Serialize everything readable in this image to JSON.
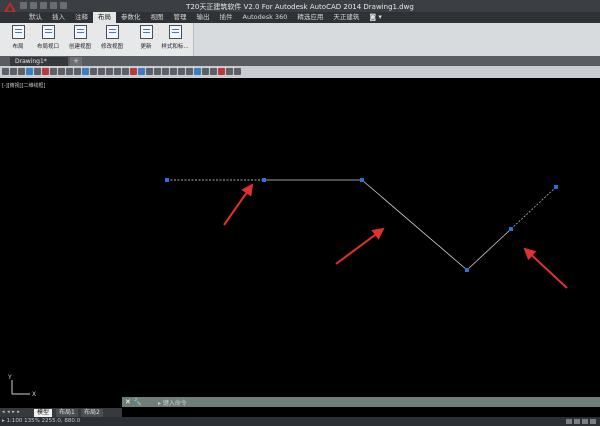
{
  "window": {
    "title": "T20天正建筑软件 V2.0 For Autodesk AutoCAD 2014    Drawing1.dwg",
    "logo_icon": "autocad-logo-icon"
  },
  "ribbon": {
    "tabs": [
      "默认",
      "插入",
      "注释",
      "布局",
      "参数化",
      "视图",
      "管理",
      "输出",
      "插件",
      "Autodesk 360",
      "精选应用",
      "天正建筑"
    ],
    "active_tab": "布局",
    "extra": "◙ ▾",
    "buttons": [
      {
        "label": "布局",
        "icon": "layout-icon"
      },
      {
        "label": "布局视口",
        "icon": "layout-viewport-icon"
      },
      {
        "label": "创建视图",
        "icon": "create-view-icon"
      },
      {
        "label": "修改视图",
        "icon": "modify-view-icon"
      },
      {
        "label": "更新",
        "icon": "update-icon"
      },
      {
        "label": "样式和标...",
        "icon": "styles-icon"
      }
    ]
  },
  "document": {
    "tab_label": "Drawing1*",
    "new_tab_icon": "+"
  },
  "viewport": {
    "label": "[-][俯视][二维线框]"
  },
  "drawing": {
    "line_color": "#d0d0d0",
    "dashed_color": "#b0b0b0",
    "grip_color": "#2f6fd6",
    "arrow_color": "#e03030"
  },
  "command": {
    "controls": "✕ 🔧",
    "prompt": "▸ 键入命令"
  },
  "layout_tabs": {
    "nav": "◂ ◂ ▸ ▸",
    "tabs": [
      "模型",
      "布局1",
      "布局2"
    ],
    "active": "模型"
  },
  "status": {
    "coords": "▸ 1:100  135%  2255.0, 880.0"
  },
  "ucs": {
    "y": "Y",
    "x": "X"
  }
}
